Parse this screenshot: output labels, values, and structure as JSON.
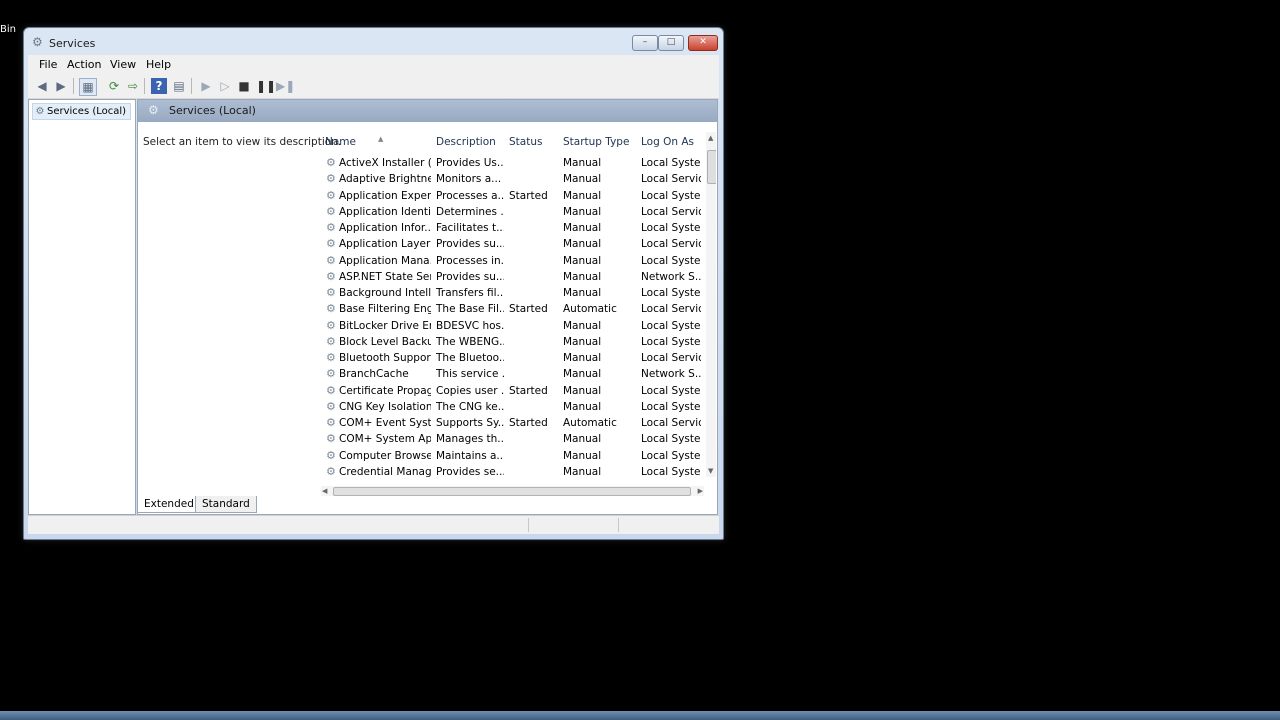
{
  "desktop": {
    "corner_text": "Bin"
  },
  "window": {
    "title": "Services",
    "controls": {
      "minimize": "–",
      "maximize": "□",
      "close": "✕"
    }
  },
  "menu": [
    "File",
    "Action",
    "View",
    "Help"
  ],
  "toolbar": {
    "icons": [
      "back-icon",
      "forward-icon",
      "show-hide-console-tree-icon",
      "refresh-icon",
      "export-list-icon",
      "help-icon",
      "properties-icon",
      "start-service-icon",
      "start-service-alt-icon",
      "stop-service-icon",
      "pause-service-icon",
      "restart-service-icon"
    ]
  },
  "tree": {
    "root_label": "Services (Local)"
  },
  "main": {
    "header_title": "Services (Local)",
    "description_prompt": "Select an item to view its description."
  },
  "table": {
    "columns": [
      "Name",
      "Description",
      "Status",
      "Startup Type",
      "Log On As"
    ],
    "rows": [
      [
        "ActiveX Installer (...",
        "Provides Us...",
        "",
        "Manual",
        "Local Syste..."
      ],
      [
        "Adaptive Brightness",
        "Monitors a...",
        "",
        "Manual",
        "Local Service"
      ],
      [
        "Application Experi...",
        "Processes a...",
        "Started",
        "Manual",
        "Local Syste..."
      ],
      [
        "Application Identity",
        "Determines ...",
        "",
        "Manual",
        "Local Service"
      ],
      [
        "Application Infor...",
        "Facilitates t...",
        "",
        "Manual",
        "Local Syste..."
      ],
      [
        "Application Layer ...",
        "Provides su...",
        "",
        "Manual",
        "Local Service"
      ],
      [
        "Application Mana...",
        "Processes in...",
        "",
        "Manual",
        "Local Syste..."
      ],
      [
        "ASP.NET State Ser...",
        "Provides su...",
        "",
        "Manual",
        "Network S..."
      ],
      [
        "Background Intelli...",
        "Transfers fil...",
        "",
        "Manual",
        "Local Syste..."
      ],
      [
        "Base Filtering Engi...",
        "The Base Fil...",
        "Started",
        "Automatic",
        "Local Service"
      ],
      [
        "BitLocker Drive En...",
        "BDESVC hos...",
        "",
        "Manual",
        "Local Syste..."
      ],
      [
        "Block Level Backu...",
        "The WBENG...",
        "",
        "Manual",
        "Local Syste..."
      ],
      [
        "Bluetooth Support...",
        "The Bluetoo...",
        "",
        "Manual",
        "Local Service"
      ],
      [
        "BranchCache",
        "This service ...",
        "",
        "Manual",
        "Network S..."
      ],
      [
        "Certificate Propag...",
        "Copies user ...",
        "Started",
        "Manual",
        "Local Syste..."
      ],
      [
        "CNG Key Isolation",
        "The CNG ke...",
        "",
        "Manual",
        "Local Syste..."
      ],
      [
        "COM+ Event Syst...",
        "Supports Sy...",
        "Started",
        "Automatic",
        "Local Service"
      ],
      [
        "COM+ System Ap...",
        "Manages th...",
        "",
        "Manual",
        "Local Syste..."
      ],
      [
        "Computer Browser",
        "Maintains a...",
        "",
        "Manual",
        "Local Syste..."
      ],
      [
        "Credential Manager",
        "Provides se...",
        "",
        "Manual",
        "Local Syste..."
      ]
    ]
  },
  "tabs": [
    "Extended",
    "Standard"
  ]
}
